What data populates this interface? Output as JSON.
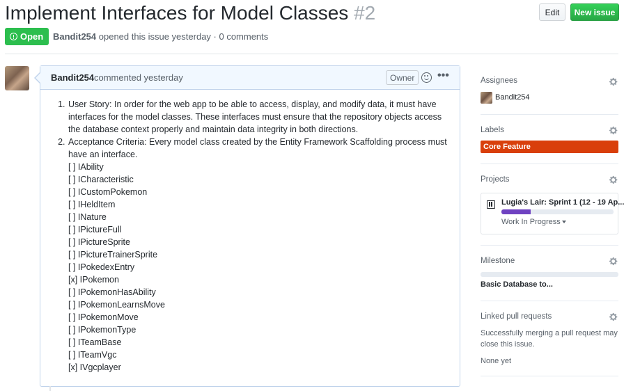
{
  "issue": {
    "title": "Implement Interfaces for Model Classes",
    "number": "#2",
    "state": "Open",
    "author": "Bandit254",
    "meta_text": "opened this issue yesterday · 0 comments"
  },
  "header_actions": {
    "edit_label": "Edit",
    "new_issue_label": "New issue"
  },
  "comment": {
    "author": "Bandit254",
    "action": "commented yesterday",
    "badge": "Owner",
    "more": "•••",
    "items": [
      {
        "text": "User Story: In order for the web app to be able to access, display, and modify data, it must have interfaces for the model classes. These interfaces must ensure that the repository objects access the database context properly and maintain data integrity in both directions."
      },
      {
        "text": "Acceptance Criteria: Every model class created by the Entity Framework Scaffolding process must have an interface.",
        "checklist": [
          "[ ] IAbility",
          "[ ] ICharacteristic",
          "[ ] ICustomPokemon",
          "[ ] IHeldItem",
          "[ ] INature",
          "[ ] IPictureFull",
          "[ ] IPictureSprite",
          "[ ] IPictureTrainerSprite",
          "[ ] IPokedexEntry",
          "[x] IPokemon",
          "[ ] IPokemonHasAbility",
          "[ ] IPokemonLearnsMove",
          "[ ] IPokemonMove",
          "[ ] IPokemonType",
          "[ ] ITeamBase",
          "[ ] ITeamVgc",
          "[x] IVgcplayer"
        ]
      }
    ]
  },
  "sidebar": {
    "assignees": {
      "heading": "Assignees",
      "name": "Bandit254"
    },
    "labels": {
      "heading": "Labels",
      "label": "Core Feature",
      "label_color": "#d93f0b"
    },
    "projects": {
      "heading": "Projects",
      "name": "Lugia's Lair: Sprint 1 (12 - 19 Ap...",
      "progress_fraction": 0.26,
      "progress_color": "#6f42c1",
      "column": "Work In Progress"
    },
    "milestone": {
      "heading": "Milestone",
      "title": "Basic Database to..."
    },
    "linked": {
      "heading": "Linked pull requests",
      "description": "Successfully merging a pull request may close this issue.",
      "value": "None yet"
    }
  },
  "icons": {
    "state": "issue-opened-icon",
    "gear": "gear-icon",
    "reaction": "smiley-icon",
    "more": "kebab-horizontal-icon",
    "project": "project-icon"
  }
}
